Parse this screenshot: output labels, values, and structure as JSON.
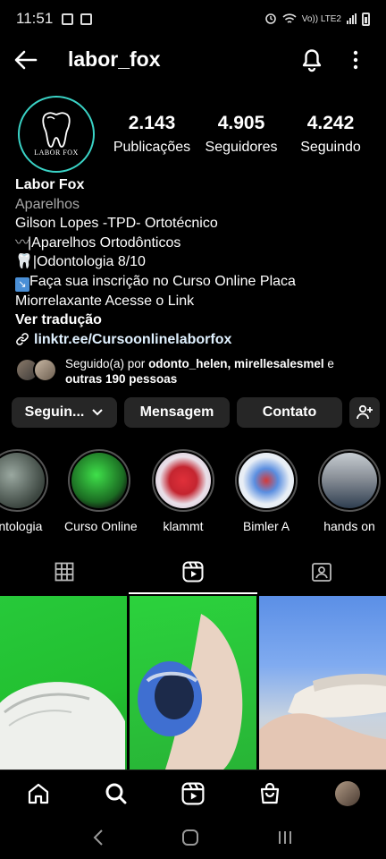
{
  "status_bar": {
    "time": "11:51",
    "network": "Vo)) LTE2"
  },
  "header": {
    "username": "labor_fox"
  },
  "profile": {
    "avatar_text": "LABOR FOX",
    "stats": [
      {
        "value": "2.143",
        "label": "Publicações"
      },
      {
        "value": "4.905",
        "label": "Seguidores"
      },
      {
        "value": "4.242",
        "label": "Seguindo"
      }
    ],
    "name": "Labor Fox",
    "category": "Aparelhos",
    "bio_line1": "Gilson Lopes -TPD- Ortotécnico",
    "bio_line2": "|Aparelhos Ortodônticos",
    "bio_line3": "|Odontologia 8/10",
    "bio_line4": "Faça sua inscrição no Curso Online Placa",
    "bio_line5": "Miorrelaxante Acesse o Link",
    "translate": "Ver tradução",
    "link": "linktr.ee/Cursoonlinelaborfox"
  },
  "followed_by": {
    "prefix": "Seguido(a) por ",
    "names": "odonto_helen, mirellesalesmel",
    "connector": " e",
    "others": "outras 190 pessoas"
  },
  "actions": {
    "following": "Seguin...",
    "message": "Mensagem",
    "contact": "Contato"
  },
  "highlights": [
    {
      "label": "ontologia"
    },
    {
      "label": "Curso Online"
    },
    {
      "label": "klammt"
    },
    {
      "label": "Bimler A"
    },
    {
      "label": "hands on"
    }
  ],
  "colors": {
    "accent_ring": "#3ad3c6",
    "button_bg": "#262626",
    "background": "#000000"
  }
}
